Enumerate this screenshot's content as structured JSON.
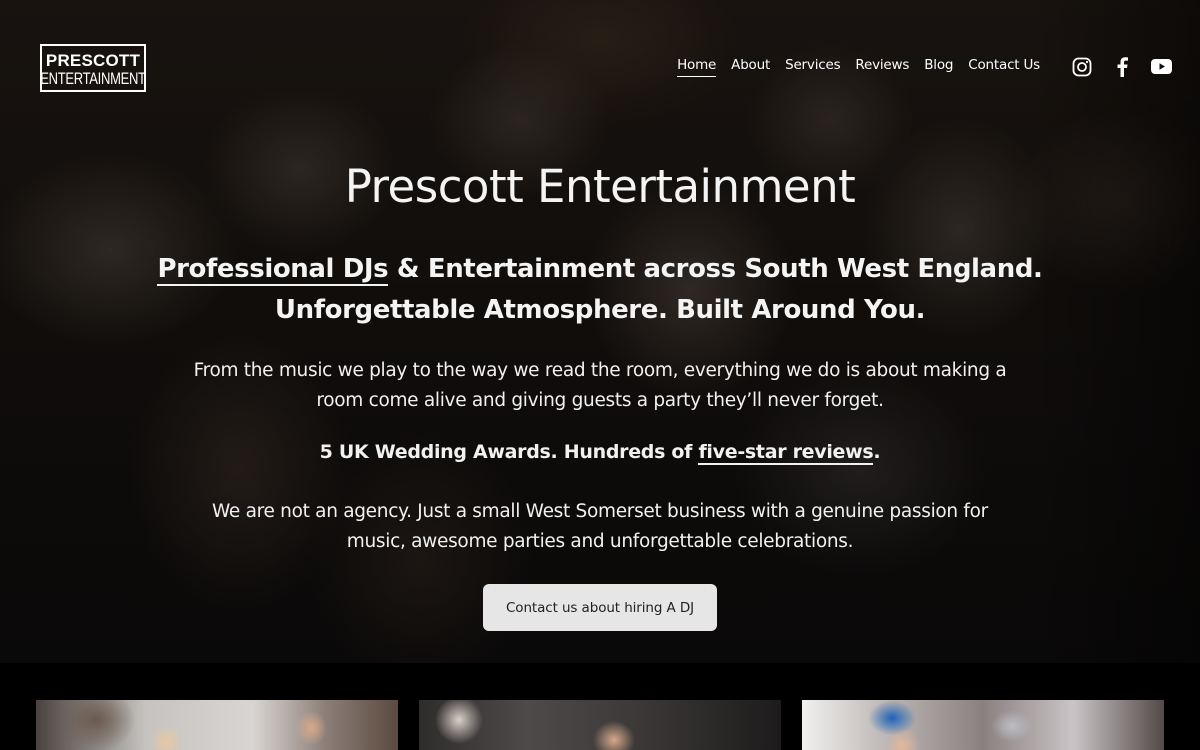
{
  "brand": {
    "logo_line1": "PRESCOTT",
    "logo_line2": "ENTERTAINMENT"
  },
  "nav": {
    "items": [
      "Home",
      "About",
      "Services",
      "Reviews",
      "Blog",
      "Contact Us"
    ],
    "active": "Home"
  },
  "social": {
    "icons": [
      "instagram-icon",
      "facebook-icon",
      "youtube-icon"
    ]
  },
  "hero": {
    "title": "Prescott Entertainment",
    "tagline_link": "Professional DJs",
    "tagline_rest": " & Entertainment across South West England.",
    "tagline_line2": "Unforgettable Atmosphere. Built Around You.",
    "paragraph1": "From the music we play to the way we read the room, everything we do is about making a room come alive and giving guests a party they’ll never forget.",
    "awards_text": "5 UK Wedding Awards. Hundreds of ",
    "awards_link": "five-star reviews",
    "awards_end": ".",
    "paragraph2": "We are not an agency. Just a small West Somerset business with a genuine passion for music, awesome parties and unforgettable celebrations.",
    "cta_label": "Contact us about hiring A DJ"
  },
  "colors": {
    "text": "#f4f4f4",
    "button_bg": "#e6e6e6",
    "button_text": "#222222",
    "page_bg": "#000000"
  }
}
